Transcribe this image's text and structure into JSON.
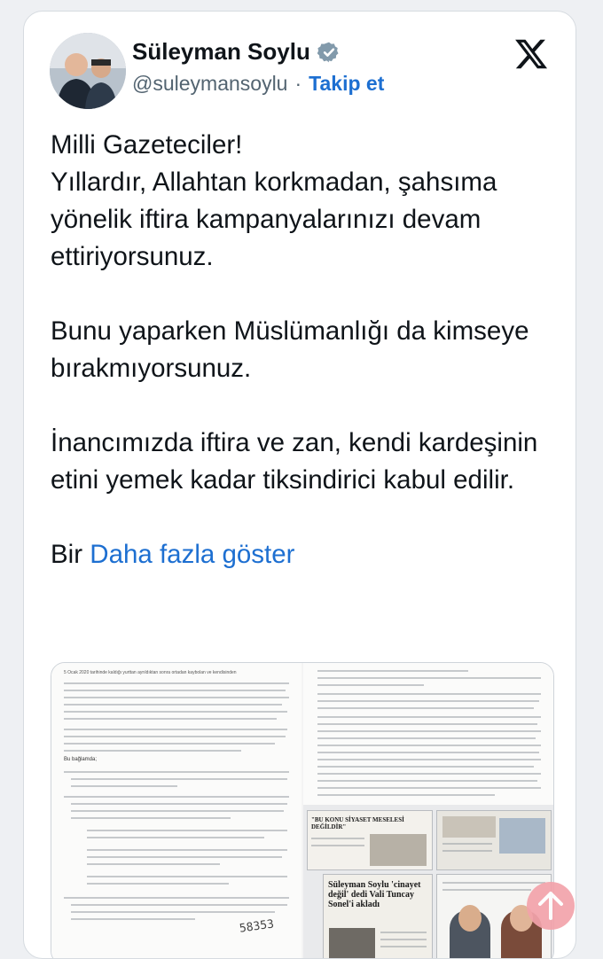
{
  "author": {
    "name": "Süleyman Soylu",
    "handle": "@suleymansoylu",
    "separator": "·",
    "follow_label": "Takip et"
  },
  "tweet": {
    "paragraphs": [
      "Milli Gazeteciler!\nYıllardır, Allahtan korkmadan, şahsıma yönelik iftira kampanyalarınızı devam ettiriyorsunuz.",
      "Bunu yaparken Müslümanlığı da kimseye bırakmıyorsunuz.",
      "İnancımızda iftira ve zan, kendi kardeşinin etini yemek kadar tiksindirici kabul edilir."
    ],
    "truncated_start": "Bir",
    "show_more_label": "Daha fazla göster"
  },
  "media": {
    "left_doc_top_line": "5 Ocak 2020 tarihinde kaldığı yurttan ayrıldıktan sonra ortadan kaybolan ve kendisinden",
    "left_doc_section": "Bu bağlamda;",
    "left_doc_number": "58353",
    "clip_headline_1": "\"BU KONU SİYASET MESELESİ DEĞİLDİR\"",
    "clip_headline_2": "Süleyman Soylu 'cinayet değil' dedi Vali Tuncay Sonel'i akladı"
  },
  "colors": {
    "link": "#1d6fd1",
    "verified": "#829aab",
    "scroll_button": "#f3a3ab"
  },
  "icons": [
    "verified-badge-icon",
    "x-logo-icon",
    "arrow-up-icon"
  ]
}
